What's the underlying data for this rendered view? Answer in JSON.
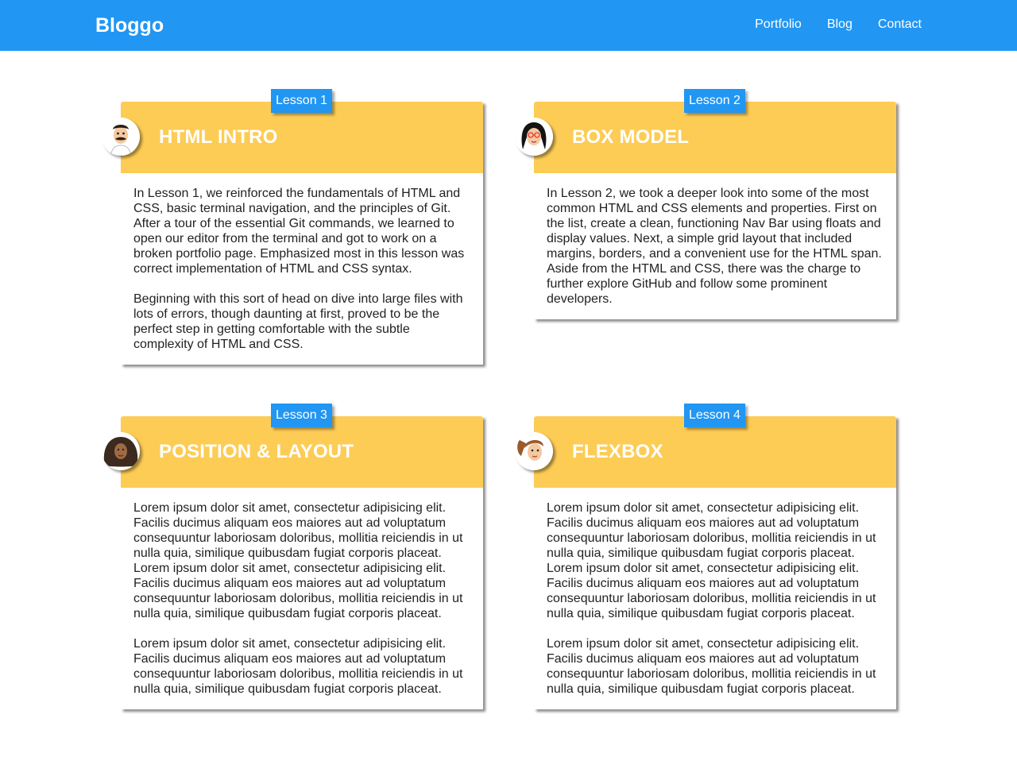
{
  "nav": {
    "brand": "Bloggo",
    "links": [
      "Portfolio",
      "Blog",
      "Contact"
    ]
  },
  "colors": {
    "navbar": "#2196f3",
    "card_header": "#fdcc55",
    "lesson_tab": "#2196f3"
  },
  "cards": [
    {
      "tab": "Lesson 1",
      "title": "HTML INTRO",
      "avatar": "man-with-mustache-avatar",
      "paragraphs": [
        "In Lesson 1, we reinforced the fundamentals of HTML and CSS, basic terminal navigation, and the principles of Git. After a tour of the essential Git commands, we learned to open our editor from the terminal and got to work on a broken portfolio page. Emphasized most in this lesson was correct implementation of HTML and CSS syntax.",
        "Beginning with this sort of head on dive into large files with lots of errors, though daunting at first, proved to be the perfect step in getting comfortable with the subtle complexity of HTML and CSS."
      ]
    },
    {
      "tab": "Lesson 2",
      "title": "BOX MODEL",
      "avatar": "woman-with-glasses-avatar",
      "paragraphs": [
        "In Lesson 2, we took a deeper look into some of the most common HTML and CSS elements and properties. First on the list, create a clean, functioning Nav Bar using floats and display values. Next, a simple grid layout that included margins, borders, and a convenient use for the HTML span. Aside from the HTML and CSS, there was the charge to further explore GitHub and follow some prominent developers."
      ]
    },
    {
      "tab": "Lesson 3",
      "title": "POSITION & LAYOUT",
      "avatar": "woman-with-curly-hair-avatar",
      "paragraphs": [
        "Lorem ipsum dolor sit amet, consectetur adipisicing elit. Facilis ducimus aliquam eos maiores aut ad voluptatum consequuntur laboriosam doloribus, mollitia reiciendis in ut nulla quia, similique quibusdam fugiat corporis placeat. Lorem ipsum dolor sit amet, consectetur adipisicing elit. Facilis ducimus aliquam eos maiores aut ad voluptatum consequuntur laboriosam doloribus, mollitia reiciendis in ut nulla quia, similique quibusdam fugiat corporis placeat.",
        "Lorem ipsum dolor sit amet, consectetur adipisicing elit. Facilis ducimus aliquam eos maiores aut ad voluptatum consequuntur laboriosam doloribus, mollitia reiciendis in ut nulla quia, similique quibusdam fugiat corporis placeat."
      ]
    },
    {
      "tab": "Lesson 4",
      "title": "FLEXBOX",
      "avatar": "woman-with-ponytail-avatar",
      "paragraphs": [
        "Lorem ipsum dolor sit amet, consectetur adipisicing elit. Facilis ducimus aliquam eos maiores aut ad voluptatum consequuntur laboriosam doloribus, mollitia reiciendis in ut nulla quia, similique quibusdam fugiat corporis placeat. Lorem ipsum dolor sit amet, consectetur adipisicing elit. Facilis ducimus aliquam eos maiores aut ad voluptatum consequuntur laboriosam doloribus, mollitia reiciendis in ut nulla quia, similique quibusdam fugiat corporis placeat.",
        "Lorem ipsum dolor sit amet, consectetur adipisicing elit. Facilis ducimus aliquam eos maiores aut ad voluptatum consequuntur laboriosam doloribus, mollitia reiciendis in ut nulla quia, similique quibusdam fugiat corporis placeat."
      ]
    }
  ]
}
